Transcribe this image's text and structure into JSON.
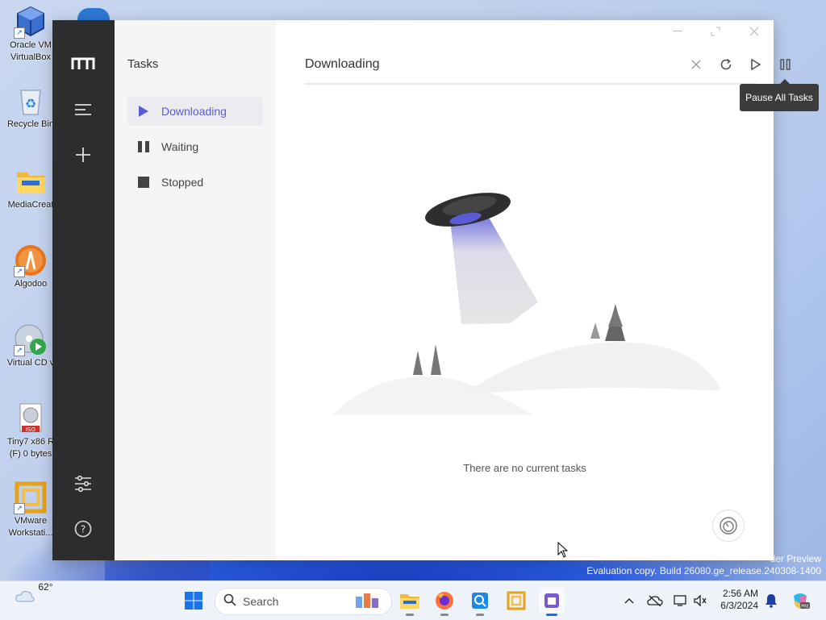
{
  "desktop": {
    "icons": [
      {
        "label": "Oracle VM VirtualBox",
        "line1": "Oracle VM",
        "line2": "VirtualBox"
      },
      {
        "label": "Recycle Bin",
        "line1": "Recycle Bin",
        "line2": ""
      },
      {
        "label": "MediaCreat",
        "line1": "MediaCreat",
        "line2": ""
      },
      {
        "label": "Algodoo",
        "line1": "Algodoo",
        "line2": ""
      },
      {
        "label": "Virtual CD v",
        "line1": "Virtual CD v",
        "line2": ""
      },
      {
        "label": "Tiny7 x86 R (F) 0 bytes",
        "line1": "Tiny7 x86 R",
        "line2": "(F) 0 bytes"
      },
      {
        "label": "VMware Workstation",
        "line1": "VMware",
        "line2": "Workstati..."
      }
    ],
    "watermark_line1": "der Preview",
    "watermark_line2": "Evaluation copy. Build 26080.ge_release.240308-1400"
  },
  "app": {
    "sidebar": {
      "title": "Tasks",
      "items": [
        {
          "label": "Downloading",
          "icon": "play-icon",
          "active": true
        },
        {
          "label": "Waiting",
          "icon": "pause-icon",
          "active": false
        },
        {
          "label": "Stopped",
          "icon": "stop-icon",
          "active": false
        }
      ]
    },
    "main": {
      "title": "Downloading",
      "tooltip": "Pause All Tasks",
      "empty_text": "There are no current tasks"
    },
    "colors": {
      "accent": "#5b5bd6",
      "rail_bg": "#2d2d2d",
      "sidebar_bg": "#f5f5f5"
    }
  },
  "taskbar": {
    "weather_temp": "62°",
    "search_placeholder": "Search",
    "time": "2:56 AM",
    "date": "6/3/2024"
  }
}
